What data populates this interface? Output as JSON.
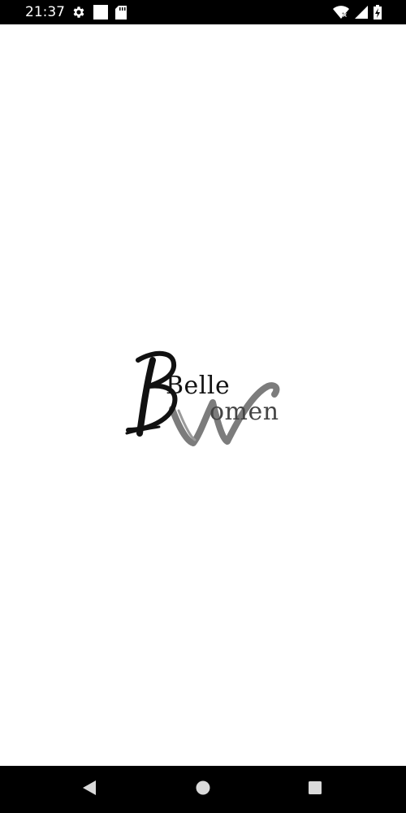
{
  "status_bar": {
    "time": "21:37",
    "left_icons": [
      "settings-icon",
      "notification-square-icon",
      "sd-card-icon"
    ],
    "right_icons": [
      "wifi-icon",
      "cell-signal-icon",
      "battery-charging-icon"
    ]
  },
  "splash": {
    "logo_text_primary": "Belle",
    "logo_text_secondary": "omen",
    "logo_monogram": [
      "B",
      "W"
    ]
  },
  "nav_bar": {
    "buttons": [
      "back-icon",
      "home-icon",
      "recents-icon"
    ]
  },
  "colors": {
    "status_bar_bg": "#000000",
    "nav_bar_bg": "#000000",
    "screen_bg": "#ffffff",
    "logo_black": "#111111",
    "logo_gray": "#6e6e6e"
  }
}
